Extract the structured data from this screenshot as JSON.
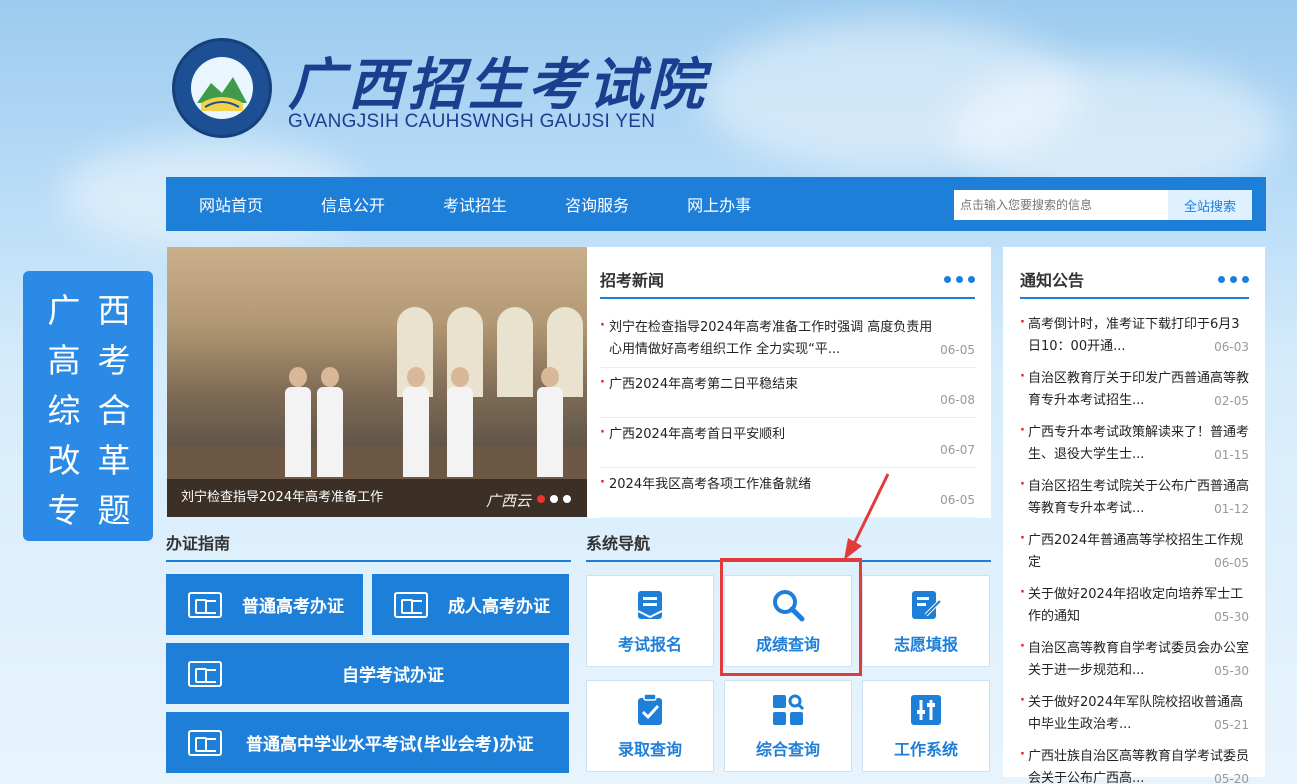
{
  "header": {
    "brand_cn": "广西招生考试院",
    "brand_en": "GVANGJSIH CAUHSWNGH GAUJSI YEN",
    "seal_text_top": "广西招生考试院",
    "seal_text_bottom": "GVANGJSIH CAUHSWNGH GAUJSI YEN"
  },
  "nav": {
    "items": [
      "网站首页",
      "信息公开",
      "考试招生",
      "咨询服务",
      "网上办事"
    ],
    "search_placeholder": "点击输入您要搜索的信息",
    "search_button": "全站搜索"
  },
  "side_banner": {
    "chars": [
      "广",
      "西",
      "高",
      "考",
      "综",
      "合",
      "改",
      "革",
      "专",
      "题"
    ]
  },
  "slide": {
    "caption": "刘宁检查指导2024年高考准备工作",
    "watermark": "广西云",
    "active_dot": 1,
    "dot_count": 3
  },
  "news": {
    "title": "招考新闻",
    "items": [
      {
        "title": "刘宁在检查指导2024年高考准备工作时强调 高度负责用心用情做好高考组织工作 全力实现“平...",
        "date": "06-05"
      },
      {
        "title": "广西2024年高考第二日平稳结束",
        "date": "06-08"
      },
      {
        "title": "广西2024年高考首日平安顺利",
        "date": "06-07"
      },
      {
        "title": "2024年我区高考各项工作准备就绪",
        "date": "06-05"
      }
    ]
  },
  "notice": {
    "title": "通知公告",
    "items": [
      {
        "title": "高考倒计时，准考证下载打印于6月3日10：00开通...",
        "date": "06-03"
      },
      {
        "title": "自治区教育厅关于印发广西普通高等教育专升本考试招生...",
        "date": "02-05"
      },
      {
        "title": "广西专升本考试政策解读来了！普通考生、退役大学生士...",
        "date": "01-15"
      },
      {
        "title": "自治区招生考试院关于公布广西普通高等教育专升本考试...",
        "date": "01-12"
      },
      {
        "title": "广西2024年普通高等学校招生工作规定",
        "date": "06-05"
      },
      {
        "title": "关于做好2024年招收定向培养军士工作的通知",
        "date": "05-30"
      },
      {
        "title": "自治区高等教育自学考试委员会办公室关于进一步规范和...",
        "date": "05-30"
      },
      {
        "title": "关于做好2024年军队院校招收普通高中毕业生政治考...",
        "date": "05-21"
      },
      {
        "title": "广西壮族自治区高等教育自学考试委员会关于公布广西高...",
        "date": "05-20"
      }
    ]
  },
  "guide": {
    "title": "办证指南",
    "buttons": [
      "普通高考办证",
      "成人高考办证",
      "自学考试办证",
      "普通高中学业水平考试(毕业会考)办证"
    ]
  },
  "system": {
    "title": "系统导航",
    "tiles": [
      {
        "label": "考试报名",
        "icon": "register-icon"
      },
      {
        "label": "成绩查询",
        "icon": "search-icon"
      },
      {
        "label": "志愿填报",
        "icon": "edit-form-icon"
      },
      {
        "label": "录取查询",
        "icon": "clipboard-check-icon"
      },
      {
        "label": "综合查询",
        "icon": "grid-search-icon"
      },
      {
        "label": "工作系统",
        "icon": "sliders-icon"
      }
    ]
  },
  "colors": {
    "primary": "#1e7fd9",
    "highlight": "#e23b3b",
    "brand_text": "#1b3f8f"
  }
}
